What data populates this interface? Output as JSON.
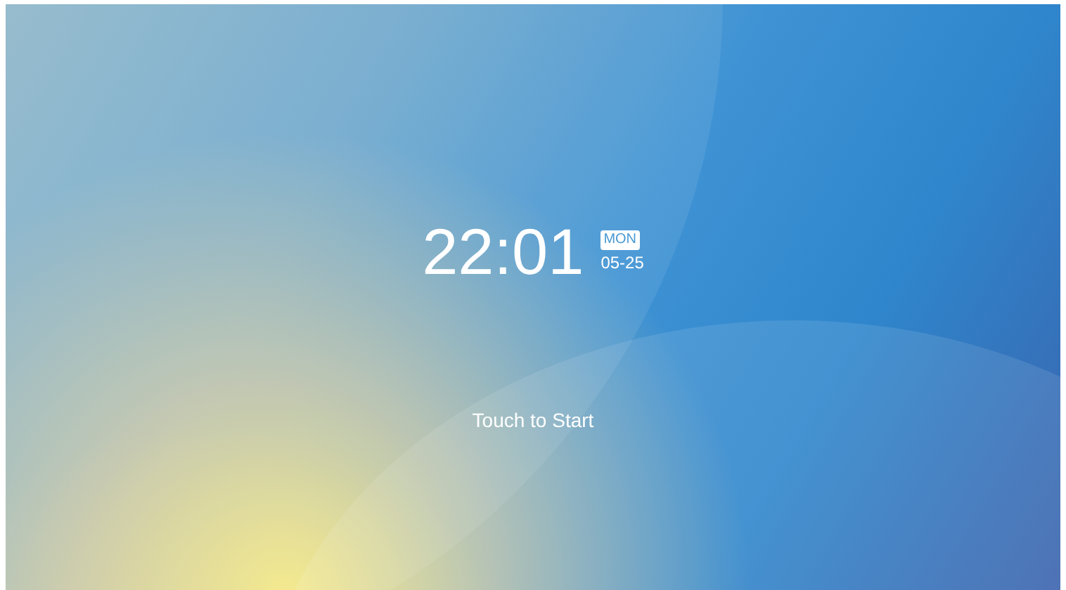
{
  "clock": {
    "time": "22:01",
    "weekday": "MON",
    "date": "05-25"
  },
  "prompt": "Touch to Start"
}
